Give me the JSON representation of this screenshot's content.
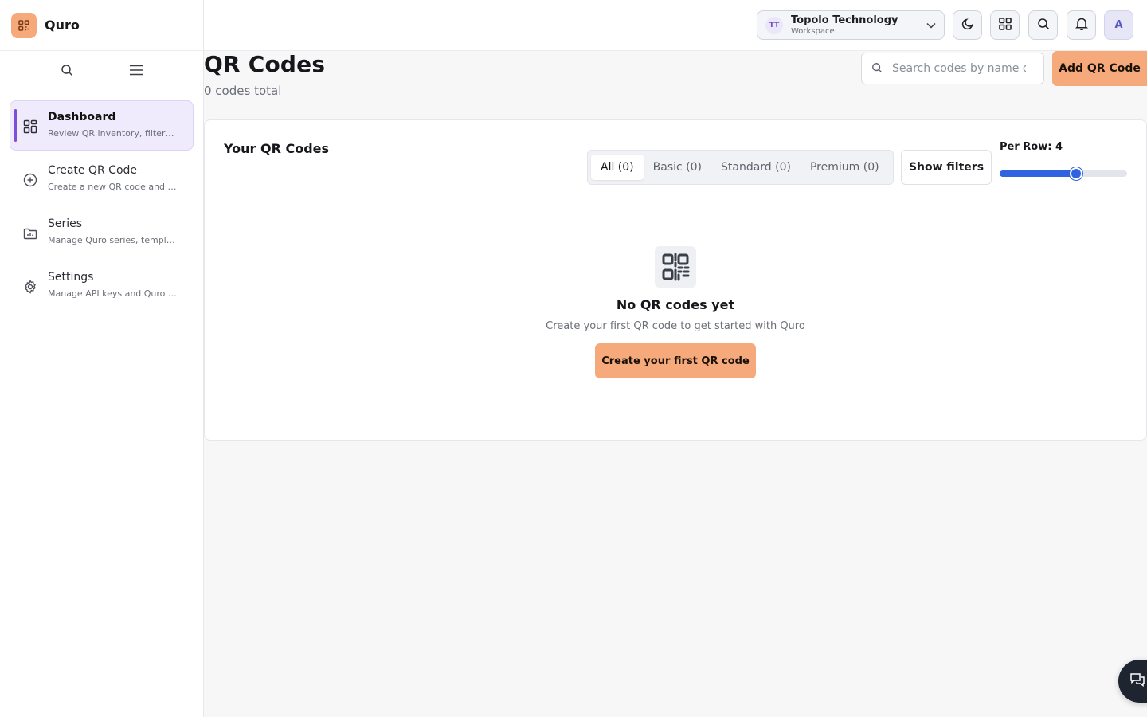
{
  "brand": {
    "name": "Quro"
  },
  "sidebar": {
    "items": [
      {
        "title": "Dashboard",
        "subtitle": "Review QR inventory, filters, and stats"
      },
      {
        "title": "Create QR Code",
        "subtitle": "Create a new QR code and configure it"
      },
      {
        "title": "Series",
        "subtitle": "Manage Quro series, templates and groups"
      },
      {
        "title": "Settings",
        "subtitle": "Manage API keys and Quro preferences"
      }
    ]
  },
  "header": {
    "workspace": {
      "initials": "TT",
      "name": "Topolo Technology",
      "role": "Workspace"
    },
    "avatar_initial": "A"
  },
  "main": {
    "title": "QR Codes",
    "count_text": "0 codes total",
    "search_placeholder": "Search codes by name or URL",
    "add_button": "Add QR Code"
  },
  "card": {
    "title": "Your QR Codes",
    "tabs": [
      {
        "label": "All (0)",
        "active": true
      },
      {
        "label": "Basic (0)",
        "active": false
      },
      {
        "label": "Standard (0)",
        "active": false
      },
      {
        "label": "Premium (0)",
        "active": false
      }
    ],
    "filters_button": "Show filters",
    "per_row": {
      "label": "Per Row: 4",
      "value": 4,
      "min": 1,
      "max": 6
    },
    "empty": {
      "title": "No QR codes yet",
      "subtitle": "Create your first QR code to get started with Quro",
      "button": "Create your first QR code"
    }
  },
  "colors": {
    "accent": "#f6a97b",
    "active_nav": "#efeafc",
    "active_bar": "#7b4fd6",
    "slider": "#2f63e0"
  }
}
